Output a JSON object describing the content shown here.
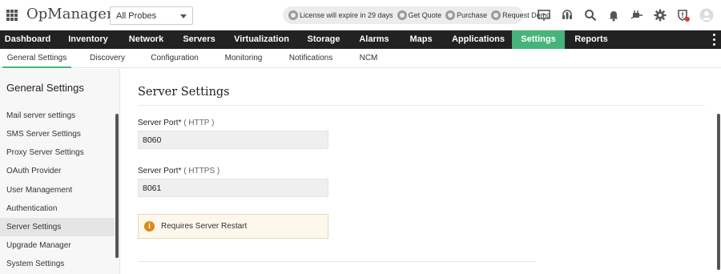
{
  "app": {
    "title": "OpManager"
  },
  "probe": {
    "selected": "All Probes"
  },
  "license_bar": {
    "items": [
      {
        "icon": "license-icon",
        "label": "License will expire in 29 days"
      },
      {
        "icon": "quote-icon",
        "label": "Get Quote"
      },
      {
        "icon": "purchase-icon",
        "label": "Purchase"
      },
      {
        "icon": "demo-icon",
        "label": "Request Demo"
      }
    ]
  },
  "toolbar_icons": [
    "presentation-icon",
    "headset-icon",
    "search-icon",
    "bell-icon",
    "plug-icon",
    "gear-icon",
    "shield-alert-icon",
    "avatar-icon"
  ],
  "main_nav": {
    "items": [
      {
        "label": "Dashboard"
      },
      {
        "label": "Inventory"
      },
      {
        "label": "Network"
      },
      {
        "label": "Servers"
      },
      {
        "label": "Virtualization"
      },
      {
        "label": "Storage"
      },
      {
        "label": "Alarms"
      },
      {
        "label": "Maps"
      },
      {
        "label": "Applications"
      },
      {
        "label": "Settings"
      },
      {
        "label": "Reports"
      }
    ],
    "active": "Settings"
  },
  "sub_nav": {
    "items": [
      {
        "label": "General Settings"
      },
      {
        "label": "Discovery"
      },
      {
        "label": "Configuration"
      },
      {
        "label": "Monitoring"
      },
      {
        "label": "Notifications"
      },
      {
        "label": "NCM"
      }
    ],
    "active": "General Settings"
  },
  "sidebar": {
    "title": "General Settings",
    "items": [
      {
        "label": "Mail server settings"
      },
      {
        "label": "SMS Server Settings"
      },
      {
        "label": "Proxy Server Settings"
      },
      {
        "label": "OAuth Provider"
      },
      {
        "label": "User Management"
      },
      {
        "label": "Authentication"
      },
      {
        "label": "Server Settings"
      },
      {
        "label": "Upgrade Manager"
      },
      {
        "label": "System Settings"
      }
    ],
    "active": "Server Settings"
  },
  "page": {
    "title": "Server Settings",
    "http": {
      "label": "Server Port*",
      "hint": "( HTTP )",
      "value": "8060"
    },
    "https": {
      "label": "Server Port*",
      "hint": "( HTTPS )",
      "value": "8061"
    },
    "notice": "Requires Server Restart"
  },
  "colors": {
    "accent": "#46b47a",
    "nav_bg": "#222222",
    "notice_bg": "#fdf8ec",
    "warning": "#d98a14",
    "alert_dot": "#e53935"
  }
}
